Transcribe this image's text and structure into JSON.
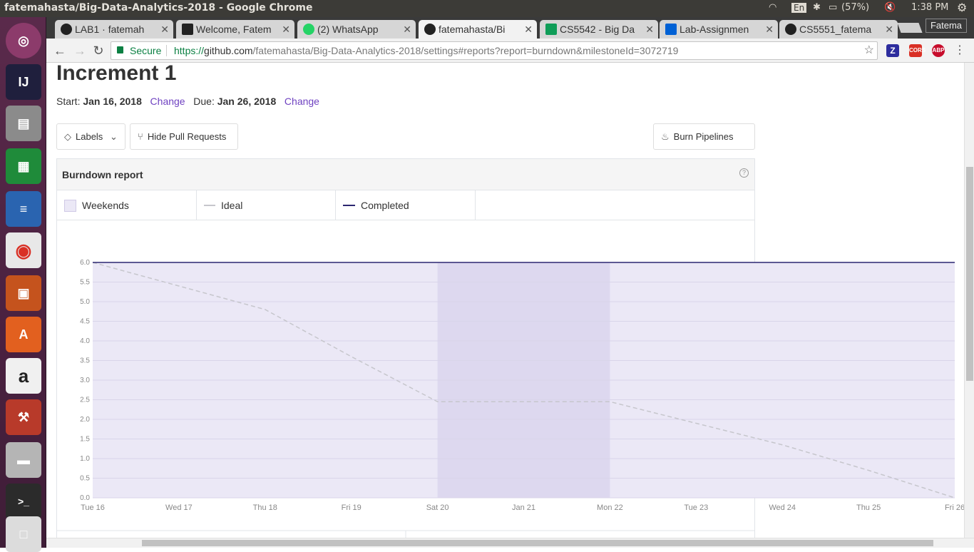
{
  "os": {
    "window_title": "fatemahasta/Big-Data-Analytics-2018 - Google Chrome",
    "language": "En",
    "battery": "(57%)",
    "clock": "1:38 PM"
  },
  "browser": {
    "tabs": [
      {
        "label": "LAB1 · fatemah"
      },
      {
        "label": "Welcome, Fatem"
      },
      {
        "label": "(2) WhatsApp"
      },
      {
        "label": "fatemahasta/Bi"
      },
      {
        "label": "CS5542 - Big Da"
      },
      {
        "label": "Lab-Assignmen"
      },
      {
        "label": "CS5551_fatema"
      }
    ],
    "profile": "Fatema",
    "secure_label": "Secure",
    "url_scheme": "https://",
    "url_host": "github.com",
    "url_path": "/fatemahasta/Big-Data-Analytics-2018/settings#reports?report=burndown&milestoneId=3072719",
    "extensions": [
      "Z",
      "CORS",
      "ABP"
    ]
  },
  "page": {
    "title": "Increment 1",
    "start_label": "Start:",
    "start_date": "Jan 16, 2018",
    "due_label": "Due:",
    "due_date": "Jan 26, 2018",
    "change_label": "Change",
    "labels_button": "Labels",
    "hide_pr_button": "Hide Pull Requests",
    "burn_button": "Burn Pipelines",
    "report_title": "Burndown report",
    "help_icon": "?",
    "legend": {
      "weekends": "Weekends",
      "ideal": "Ideal",
      "completed": "Completed"
    }
  },
  "colors": {
    "weekend_fill": "#ddd8ef",
    "plot_fill": "#ebe8f6",
    "ideal_line": "#c6c6cc",
    "completed_line": "#2b2670",
    "link": "#6f42c1"
  },
  "chart_data": {
    "type": "line",
    "categories": [
      "Tue 16",
      "Wed 17",
      "Thu 18",
      "Fri 19",
      "Sat 20",
      "Jan 21",
      "Mon 22",
      "Tue 23",
      "Wed 24",
      "Thu 25",
      "Fri 26"
    ],
    "yticks": [
      "0.0",
      "0.5",
      "1.0",
      "1.5",
      "2.0",
      "2.5",
      "3.0",
      "3.5",
      "4.0",
      "4.5",
      "5.0",
      "5.5",
      "6.0"
    ],
    "ylim": [
      0,
      6
    ],
    "weekend_span": [
      "Sat 20",
      "Mon 22"
    ],
    "series": [
      {
        "name": "Ideal",
        "values": [
          6.0,
          5.4,
          4.8,
          3.6,
          2.45,
          2.45,
          2.45,
          1.9,
          1.35,
          0.7,
          0.0
        ]
      },
      {
        "name": "Completed",
        "values": [
          6.0,
          6.0,
          6.0,
          6.0,
          6.0,
          6.0,
          6.0,
          6.0,
          6.0,
          6.0,
          6.0
        ]
      }
    ]
  }
}
